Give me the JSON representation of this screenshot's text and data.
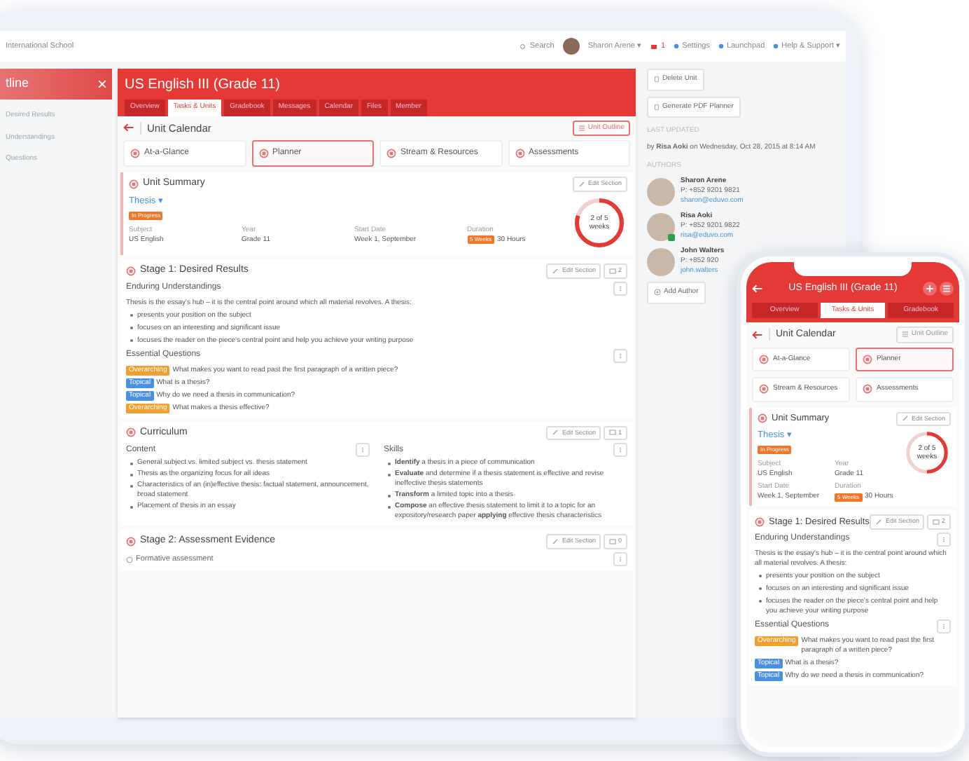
{
  "tablet": {
    "top_bar": {
      "school": "International School",
      "search": "Search",
      "user": "Sharon Arene ▾",
      "mail_count": "1",
      "links": [
        "Settings",
        "Launchpad",
        "Help & Support ▾"
      ]
    },
    "sidebar": {
      "title": "tline",
      "items": [
        "Desired Results",
        "Understandings",
        "Questions"
      ]
    },
    "course": {
      "title": "US English III (Grade 11)",
      "tabs": [
        {
          "label": "Overview",
          "selected": false
        },
        {
          "label": "Tasks & Units",
          "selected": true
        },
        {
          "label": "Gradebook",
          "selected": false
        },
        {
          "label": "Messages",
          "selected": false
        },
        {
          "label": "Calendar",
          "selected": false
        },
        {
          "label": "Files",
          "selected": false
        },
        {
          "label": "Member",
          "selected": false
        }
      ]
    },
    "page_title": "Unit Calendar",
    "outline_button": "Unit Outline",
    "views": [
      {
        "label": "At-a-Glance",
        "selected": false
      },
      {
        "label": "Planner",
        "selected": true
      },
      {
        "label": "Stream & Resources",
        "selected": false
      },
      {
        "label": "Assessments",
        "selected": false
      }
    ],
    "summary": {
      "title": "Unit Summary",
      "edit": "Edit Section",
      "unit_name": "Thesis ▾",
      "status": "In Progress",
      "fields": [
        {
          "label": "Subject",
          "value": "US English"
        },
        {
          "label": "Year",
          "value": "Grade 11"
        },
        {
          "label": "Start Date",
          "value": "Week 1, September"
        },
        {
          "label": "Duration",
          "badge": "5 Weeks",
          "value": "30 Hours"
        }
      ],
      "progress": {
        "text": "2 of 5 weeks",
        "level": 0.8
      }
    },
    "stage1": {
      "title": "Stage 1: Desired Results",
      "edit": "Edit Section",
      "comments": "2",
      "understandings": {
        "title": "Enduring Understandings",
        "intro": "Thesis is the essay's hub – it is the central point around which all material revolves. A thesis:",
        "bullets": [
          "presents your position on the subject",
          "focuses on an interesting and significant issue",
          "focuses the reader on the piece's central point and help you achieve your writing purpose"
        ]
      },
      "questions": {
        "title": "Essential Questions",
        "items": [
          {
            "kind": "overarching",
            "tag": "Overarching",
            "text": "What makes you want to read past the first paragraph of a written piece?"
          },
          {
            "kind": "topical",
            "tag": "Topical",
            "text": "What is a thesis?"
          },
          {
            "kind": "topical",
            "tag": "Topical",
            "text": "Why do we need a thesis in communication?"
          },
          {
            "kind": "overarching",
            "tag": "Overarching",
            "text": "What makes a thesis effective?"
          }
        ]
      }
    },
    "curriculum": {
      "title": "Curriculum",
      "edit": "Edit Section",
      "comments": "1",
      "columns": [
        {
          "title": "Content",
          "bullets": [
            "General subject vs. limited subject vs. thesis statement",
            "Thesis as the organizing focus for all ideas",
            "Characteristics of an (in)effective thesis: factual statement, announcement, broad statement",
            "Placement of thesis in an essay"
          ]
        },
        {
          "title": "Skills",
          "bullets": [
            "**Identify** a thesis in a piece of communication",
            "**Evaluate** and determine if a thesis statement is effective and revise ineffective thesis statements",
            "**Transform** a limited topic into a thesis",
            "**Compose** an effective thesis statement to limit it to a topic for an expository/research paper **applying** effective thesis characteristics"
          ]
        }
      ]
    },
    "stage2": {
      "title": "Stage 2: Assessment Evidence",
      "edit": "Edit Section",
      "comments": "0",
      "items": [
        "Formative assessment"
      ]
    },
    "right_panel": {
      "buttons": [
        "Delete Unit",
        "Generate PDF Planner"
      ],
      "last_updated_label": "LAST UPDATED",
      "last_updated": "by **Risa Aoki** on Wednesday, Oct 28, 2015 at 8:14 AM",
      "authors_label": "AUTHORS",
      "authors": [
        {
          "name": "Sharon Arene",
          "phone": "P: +852 9201 9821",
          "email": "sharon@eduvo.com",
          "online": false
        },
        {
          "name": "Risa Aoki",
          "phone": "P: +852 9201 9822",
          "email": "risa@eduvo.com",
          "online": true
        },
        {
          "name": "John Walters",
          "phone": "P: +852 920",
          "email": "john.walters",
          "online": false
        }
      ],
      "add_author": "Add Author"
    }
  },
  "phone": {
    "title": "US English III (Grade 11)",
    "tabs": [
      {
        "label": "Overview",
        "selected": false
      },
      {
        "label": "Tasks & Units",
        "selected": true
      },
      {
        "label": "Gradebook",
        "selected": false
      }
    ],
    "page_title": "Unit Calendar",
    "outline_button": "Unit Outline",
    "views": [
      {
        "label": "At-a-Glance",
        "selected": false
      },
      {
        "label": "Planner",
        "selected": true
      },
      {
        "label": "Stream & Resources",
        "selected": false
      },
      {
        "label": "Assessments",
        "selected": false
      }
    ],
    "summary": {
      "title": "Unit Summary",
      "edit": "Edit Section",
      "unit_name": "Thesis ▾",
      "status": "In Progress",
      "fields": [
        {
          "label": "Subject",
          "value": "US English"
        },
        {
          "label": "Year",
          "value": "Grade 11"
        },
        {
          "label": "Start Date",
          "value": "Week 1, September"
        },
        {
          "label": "Duration",
          "badge": "5 Weeks",
          "value": "30 Hours"
        }
      ],
      "progress": {
        "text": "2 of 5 weeks",
        "level": 0.5
      }
    },
    "stage1": {
      "title": "Stage 1: Desired Results",
      "edit": "Edit Section",
      "comments": "2",
      "understandings": {
        "title": "Enduring Understandings",
        "intro": "Thesis is the essay's hub – it is the central point around which all material revolves. A thesis:",
        "bullets": [
          "presents your position on the subject",
          "focuses on an interesting and significant issue",
          "focuses the reader on the piece's central point and help you achieve your writing purpose"
        ]
      },
      "questions": {
        "title": "Essential Questions",
        "items": [
          {
            "kind": "overarching",
            "tag": "Overarching",
            "text": "What makes you want to read past the first paragraph of a written piece?"
          },
          {
            "kind": "topical",
            "tag": "Topical",
            "text": "What is a thesis?"
          },
          {
            "kind": "topical",
            "tag": "Topical",
            "text": "Why do we need a thesis in communication?"
          }
        ]
      }
    }
  }
}
